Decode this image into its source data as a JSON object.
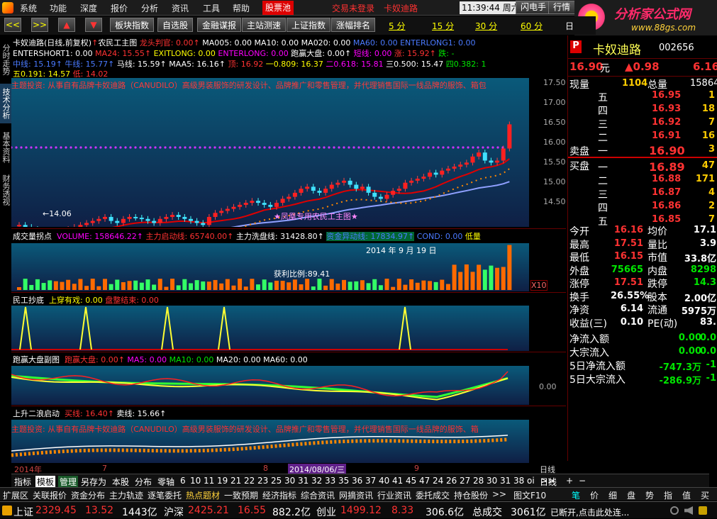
{
  "menu": {
    "items": [
      "系统",
      "功能",
      "深度",
      "报价",
      "分析",
      "资讯",
      "工具",
      "帮助"
    ],
    "active": "股票池",
    "login": "交易未登录",
    "stock_link": "卡奴迪路",
    "time": "11:39:44",
    "weekday": "周六",
    "btn1": "闪电手",
    "btn2": "行情"
  },
  "logo": {
    "title": "分析家公式网",
    "url": "www.88gs.com"
  },
  "toolbar": {
    "nav": [
      "<<",
      ">>",
      "▲",
      "▼"
    ],
    "buttons": [
      "板块指数",
      "自选股",
      "金融谋报",
      "主站测速",
      "上证指数",
      "涨幅排名"
    ],
    "periods": [
      "5 分",
      "15 分",
      "30 分",
      "60 分",
      "日"
    ]
  },
  "rail": {
    "tabs": [
      "分时走势",
      "技术分析",
      "基本资料",
      "财务透视"
    ]
  },
  "main": {
    "row1": {
      "name": "卡奴迪路(日线,前复权)",
      "arrow": "↑",
      "title": "农民工主图",
      "a": "龙头判官: 0.00↑",
      "b": "MA005: 0.00",
      "c": "MA10: 0.00",
      "d": "MA020: 0.00",
      "e": "MA60: 0.00",
      "f": "ENTERLONG1: 0.00"
    },
    "row2": {
      "a": "ENTERSHORT1: 0.00",
      "b": "MA24: 15.55↑",
      "c": "EXITLONG: 0.00",
      "d": "ENTERLONG: 0.00",
      "e": "跑赢大盘: 0.00↑",
      "f": "短线: 0.00",
      "g": "涨: 15.92↑",
      "h": "跌: -"
    },
    "row3": {
      "a": "中线: 15.19↑",
      "b": "牛线: 15.77↑",
      "c": "马线: 15.59↑",
      "d": "MAA5: 16.16↑",
      "e": "顶: 16.92",
      "f": "一0.809: 16.37",
      "g": "二0.618: 15.81",
      "h": "三0.500: 15.47",
      "i": "四0.382: 1"
    },
    "row4": {
      "a": "五0.191: 14.57",
      "b": "低: 14.02"
    },
    "marquee": "主题投资: 从事自有品牌卡奴迪路（CANUDILO）高级男装服饰的研发设计、品牌推广和零售管理，并代理销售国际一线品牌的服饰、箱包",
    "low_label": "←14.06",
    "watermark": "★凤凰专用农民工主图★",
    "yticks": [
      "17.50",
      "17.00",
      "16.50",
      "16.00",
      "15.50",
      "15.00",
      "14.50"
    ]
  },
  "vol": {
    "a": "成交量拐点",
    "b": "VOLUME: 158646.22↑",
    "c": "主力启动线: 65740.00↑",
    "d": "主力洗盘线: 31428.80↑",
    "e": "资金异动线: 17834.97↑",
    "f": "COND: 0.00",
    "g": "低量",
    "date": "2014 年 9 月 19 日",
    "profit": "获利比例:89.41",
    "x10": "X10"
  },
  "mg": {
    "a": "民工抄底",
    "b": "上穿有戏: 0.00",
    "c": "盘整结束: 0.00"
  },
  "pao": {
    "a": "跑赢大盘副图",
    "b": "跑赢大盘: 0.00↑",
    "c": "MA5: 0.00",
    "d": "MA10: 0.00",
    "e": "MA20: 0.00",
    "f": "MA60: 0.00",
    "tick": "0.00"
  },
  "sheng": {
    "a": "上升二浪启动",
    "b": "买线: 16.40↑",
    "c": "卖线: 15.66↑",
    "marquee": "主题投资: 从事自有品牌卡奴迪路（CANUDILO）高级男装服饰的研发设计、品牌推广和零售管理，并代理销售国际一线品牌的服饰、箱"
  },
  "timeaxis": {
    "year": "2014年",
    "m7": "7",
    "m8": "8",
    "date": "2014/08/06/三",
    "m9": "9",
    "period": "日线"
  },
  "quote": {
    "flag": "P",
    "name": "卡奴迪路",
    "code": "002656",
    "price": "16.90",
    "unit": "元",
    "chg": "▲0.98",
    "pct": "6.16",
    "now_l": "现量",
    "now_v": "1104",
    "tot_l": "总量",
    "tot_v": "15864",
    "sell": [
      {
        "l": "五",
        "p": "16.95",
        "v": "1"
      },
      {
        "l": "四",
        "p": "16.93",
        "v": "18"
      },
      {
        "l": "三",
        "p": "16.92",
        "v": "7"
      },
      {
        "l": "二",
        "p": "16.91",
        "v": "16"
      },
      {
        "l": "一",
        "p": "16.90",
        "v": "3"
      }
    ],
    "sell_head": "卖盘",
    "buy_head": "买盘",
    "buy": [
      {
        "l": "一",
        "p": "16.89",
        "v": "47"
      },
      {
        "l": "二",
        "p": "16.88",
        "v": "171"
      },
      {
        "l": "三",
        "p": "16.87",
        "v": "4"
      },
      {
        "l": "四",
        "p": "16.86",
        "v": "2"
      },
      {
        "l": "五",
        "p": "16.85",
        "v": "7"
      }
    ],
    "stats": [
      {
        "l1": "今开",
        "v1": "16.16",
        "l2": "均价",
        "v2": "17.1"
      },
      {
        "l1": "最高",
        "v1": "17.51",
        "l2": "量比",
        "v2": "3.9"
      },
      {
        "l1": "最低",
        "v1": "16.15",
        "l2": "市值",
        "v2": "33.8亿"
      },
      {
        "l1": "外盘",
        "v1": "75665",
        "l2": "内盘",
        "v2": "8298"
      },
      {
        "l1": "涨停",
        "v1": "17.51",
        "l2": "跌停",
        "v2": "14.3"
      },
      {
        "l1": "换手",
        "v1": "26.55%",
        "l2": "股本",
        "v2": "2.00亿"
      },
      {
        "l1": "净资",
        "v1": "6.14",
        "l2": "流通",
        "v2": "5975万"
      },
      {
        "l1": "收益(三)",
        "v1": "0.10",
        "l2": "PE(动)",
        "v2": "83."
      }
    ],
    "flows": [
      {
        "l": "净流入额",
        "v1": "0.00",
        "v2": "0.0"
      },
      {
        "l": "大宗流入",
        "v1": "0.00",
        "v2": "0.0"
      },
      {
        "l": "5日净流入额",
        "v1": "-747.3万",
        "v2": "-1"
      },
      {
        "l": "5日大宗流入",
        "v1": "-286.9万",
        "v2": "-1"
      }
    ]
  },
  "tabs": {
    "items": [
      "指标",
      "模板",
      "管理",
      "另存为",
      "本股",
      "分布",
      "零轴"
    ],
    "nums": [
      "6",
      "10",
      "11",
      "19",
      "21",
      "22",
      "23",
      "25",
      "30",
      "31",
      "32",
      "33",
      "35",
      "36",
      "37",
      "40",
      "41",
      "45",
      "47",
      "24",
      "26",
      "27",
      "28",
      "30",
      "31",
      "38",
      "oi",
      ">>"
    ],
    "tail": [
      "日线",
      "+",
      "−"
    ]
  },
  "funcs": {
    "items": [
      "扩展区",
      "关联报价",
      "资金分布",
      "主力轨迹",
      "逐笔委托",
      "热点题材",
      "一致预期",
      "经济指标",
      "综合资讯",
      "网摘资讯",
      "行业资讯",
      "委托成交",
      "持仓股份",
      ">>",
      "图文F10"
    ],
    "right": [
      "笔",
      "价",
      "细",
      "盘",
      "势",
      "指",
      "值",
      "买"
    ]
  },
  "status": {
    "sh_l": "上证",
    "sh_v": "2329.45",
    "sh_c": "13.52",
    "sh_a": "1443亿",
    "hs_l": "沪深",
    "hs_v": "2425.21",
    "hs_c": "16.55",
    "hs_a": "882.2亿",
    "cy_l": "创业",
    "cy_v": "1499.12",
    "cy_c": "8.33",
    "cy_a": "306.6亿",
    "tot_l": "总成交",
    "tot_v": "3061亿",
    "msg": "已断开,点击此处连..."
  }
}
